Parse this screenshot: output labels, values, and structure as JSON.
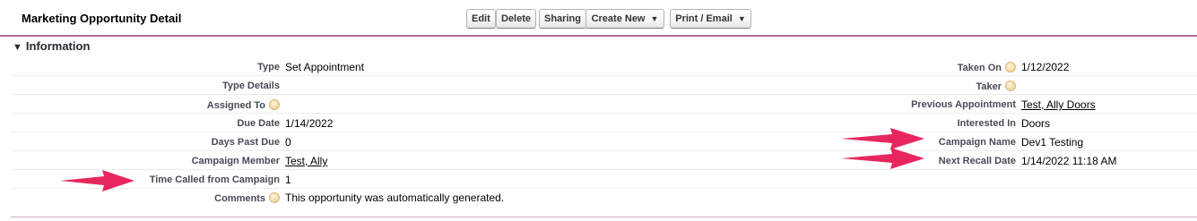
{
  "header": {
    "title": "Marketing Opportunity Detail",
    "buttons": {
      "edit": "Edit",
      "delete": "Delete",
      "sharing": "Sharing",
      "create_new": "Create New",
      "print_email": "Print / Email"
    }
  },
  "section": {
    "title": "Information"
  },
  "fields": {
    "type": {
      "label": "Type",
      "value": "Set Appointment"
    },
    "type_details": {
      "label": "Type Details",
      "value": ""
    },
    "assigned_to": {
      "label": "Assigned To",
      "value": ""
    },
    "due_date": {
      "label": "Due Date",
      "value": "1/14/2022"
    },
    "days_past_due": {
      "label": "Days Past Due",
      "value": "0"
    },
    "campaign_member": {
      "label": "Campaign Member",
      "value": "Test, Ally"
    },
    "time_called": {
      "label": "Time Called from Campaign",
      "value": "1"
    },
    "comments": {
      "label": "Comments",
      "value": "This opportunity was automatically generated."
    },
    "taken_on": {
      "label": "Taken On",
      "value": "1/12/2022"
    },
    "taker": {
      "label": "Taker",
      "value": ""
    },
    "previous_appointment": {
      "label": "Previous Appointment",
      "value": "Test, Ally Doors"
    },
    "interested_in": {
      "label": "Interested In",
      "value": "Doors"
    },
    "campaign_name": {
      "label": "Campaign Name",
      "value": "Dev1 Testing"
    },
    "next_recall_date": {
      "label": "Next Recall Date",
      "value": "1/14/2022 11:18 AM"
    }
  },
  "colors": {
    "header_border": "#b6689f",
    "annotation_arrow": "#e8265e"
  },
  "icons": {
    "help": "help-bubble-icon",
    "caret": "caret-down-icon",
    "collapse": "section-collapse-triangle-icon"
  }
}
